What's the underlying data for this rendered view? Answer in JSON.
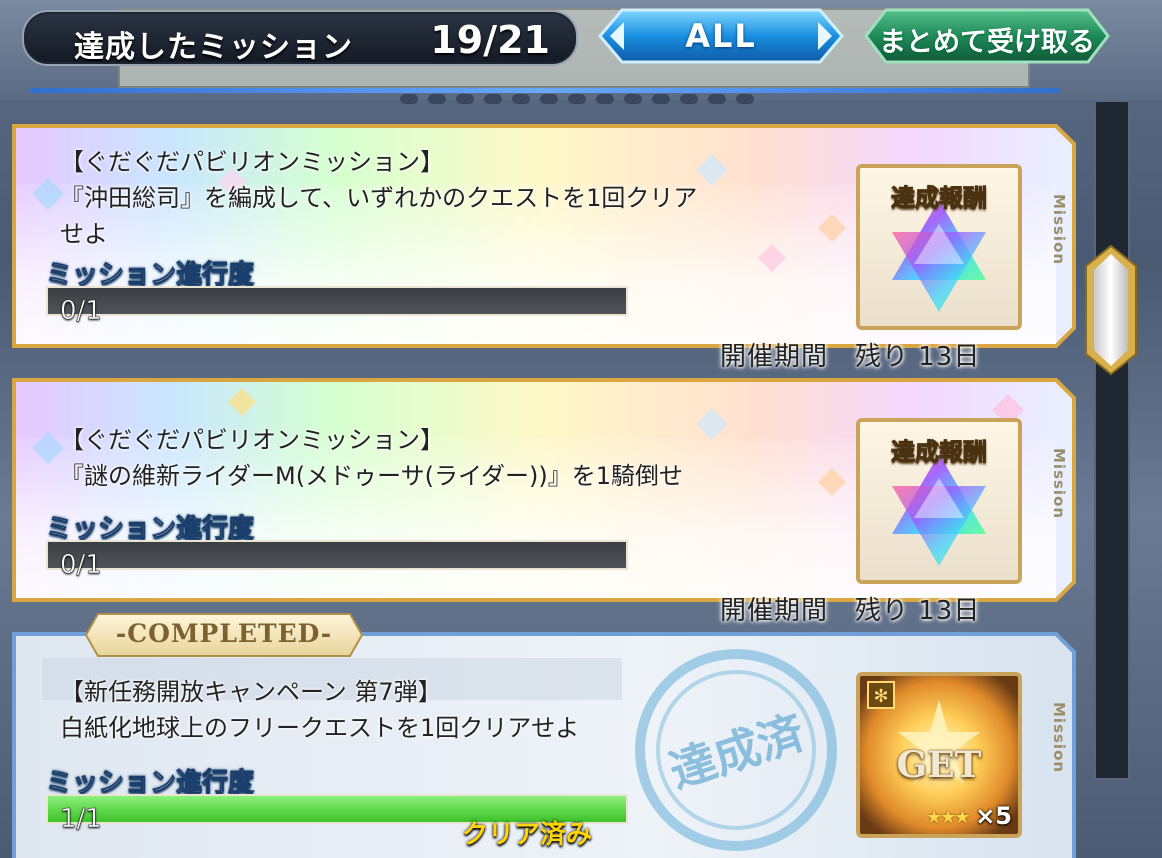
{
  "header": {
    "title": "達成したミッション",
    "count": "19/21",
    "filter_label": "ALL",
    "bulk_claim_label": "まとめて受け取る"
  },
  "missions": [
    {
      "lines": [
        "【ぐだぐだパビリオンミッション】",
        "『沖田総司』を編成して、いずれかのクエストを1回クリア",
        "せよ"
      ],
      "progress_label": "ミッション進行度",
      "progress_value": "0/1",
      "progress_fraction": 0,
      "reward_title": "達成報酬",
      "period": "開催期間　残り 13日",
      "side_label": "Mission"
    },
    {
      "lines": [
        "【ぐだぐだパビリオンミッション】",
        "『謎の維新ライダーM(メドゥーサ(ライダー))』を1騎倒せ"
      ],
      "progress_label": "ミッション進行度",
      "progress_value": "0/1",
      "progress_fraction": 0,
      "reward_title": "達成報酬",
      "period": "開催期間　残り 13日",
      "side_label": "Mission"
    },
    {
      "completed_tag": "-COMPLETED-",
      "lines": [
        "【新任務開放キャンペーン 第7弾】",
        "白紙化地球上のフリークエストを1回クリアせよ"
      ],
      "progress_label": "ミッション進行度",
      "progress_value": "1/1",
      "progress_fraction": 1,
      "clear_label": "クリア済み",
      "stamp_text": "達成済",
      "reward_get": "GET",
      "reward_qty": "×5",
      "side_label": "Mission"
    }
  ],
  "colors": {
    "gold_frame": "#d9a641",
    "blue_frame": "#6fa0d8",
    "progress_green": "#3cc228",
    "filter_blue": "#1a8fe0",
    "bulk_green": "#1f8a5a"
  }
}
